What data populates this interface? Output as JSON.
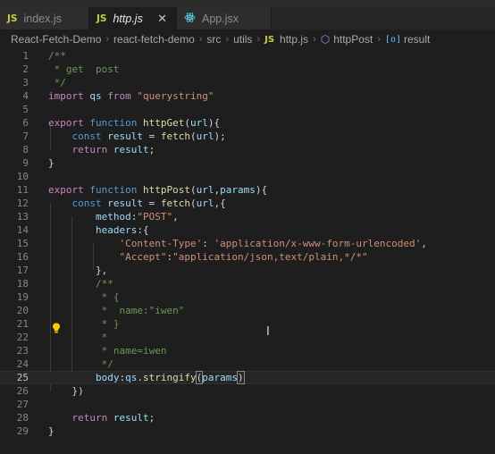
{
  "tabs": [
    {
      "icon": "JS",
      "label": "index.js"
    },
    {
      "icon": "JS",
      "label": "http.js",
      "close": "✕"
    },
    {
      "icon": "react",
      "label": "App.jsx"
    }
  ],
  "breadcrumb": [
    "React-Fetch-Demo",
    "react-fetch-demo",
    "src",
    "utils",
    "http.js",
    "httpPost",
    "result"
  ],
  "breadcrumb_icon_js": "JS",
  "line_numbers": [
    "1",
    "2",
    "3",
    "4",
    "5",
    "6",
    "7",
    "8",
    "9",
    "10",
    "11",
    "12",
    "13",
    "14",
    "15",
    "16",
    "17",
    "18",
    "19",
    "20",
    "21",
    "22",
    "23",
    "24",
    "25",
    "26",
    "27",
    "28",
    "29"
  ],
  "active_line": 25,
  "code_lines": [
    [
      [
        "cmt",
        "/**"
      ]
    ],
    [
      [
        "cmt",
        " * get  post"
      ]
    ],
    [
      [
        "cmt",
        " */"
      ]
    ],
    [
      [
        "kw",
        "import"
      ],
      [
        "pl",
        " "
      ],
      [
        "var",
        "qs"
      ],
      [
        "pl",
        " "
      ],
      [
        "kw",
        "from"
      ],
      [
        "pl",
        " "
      ],
      [
        "str",
        "\"querystring\""
      ]
    ],
    [],
    [
      [
        "kw",
        "export"
      ],
      [
        "pl",
        " "
      ],
      [
        "kb",
        "function"
      ],
      [
        "pl",
        " "
      ],
      [
        "fn",
        "httpGet"
      ],
      [
        "pl",
        "("
      ],
      [
        "var",
        "url"
      ],
      [
        "pl",
        "){"
      ]
    ],
    [
      [
        "pl",
        "    "
      ],
      [
        "kb",
        "const"
      ],
      [
        "pl",
        " "
      ],
      [
        "var",
        "result"
      ],
      [
        "pl",
        " = "
      ],
      [
        "fn",
        "fetch"
      ],
      [
        "pl",
        "("
      ],
      [
        "var",
        "url"
      ],
      [
        "pl",
        ");"
      ]
    ],
    [
      [
        "pl",
        "    "
      ],
      [
        "kw",
        "return"
      ],
      [
        "pl",
        " "
      ],
      [
        "var",
        "result"
      ],
      [
        "pl",
        ";"
      ]
    ],
    [
      [
        "pl",
        "}"
      ]
    ],
    [],
    [
      [
        "kw",
        "export"
      ],
      [
        "pl",
        " "
      ],
      [
        "kb",
        "function"
      ],
      [
        "pl",
        " "
      ],
      [
        "fn",
        "httpPost"
      ],
      [
        "pl",
        "("
      ],
      [
        "var",
        "url"
      ],
      [
        "pl",
        ","
      ],
      [
        "var",
        "params"
      ],
      [
        "pl",
        "){"
      ]
    ],
    [
      [
        "pl",
        "    "
      ],
      [
        "kb",
        "const"
      ],
      [
        "pl",
        " "
      ],
      [
        "var",
        "result"
      ],
      [
        "pl",
        " = "
      ],
      [
        "fn",
        "fetch"
      ],
      [
        "pl",
        "("
      ],
      [
        "var",
        "url"
      ],
      [
        "pl",
        ",{"
      ]
    ],
    [
      [
        "pl",
        "        "
      ],
      [
        "var",
        "method"
      ],
      [
        "pl",
        ":"
      ],
      [
        "str",
        "\"POST\""
      ],
      [
        "pl",
        ","
      ]
    ],
    [
      [
        "pl",
        "        "
      ],
      [
        "var",
        "headers"
      ],
      [
        "pl",
        ":{"
      ]
    ],
    [
      [
        "pl",
        "            "
      ],
      [
        "str",
        "'Content-Type'"
      ],
      [
        "pl",
        ": "
      ],
      [
        "str",
        "'application/x-www-form-urlencoded'"
      ],
      [
        "pl",
        ","
      ]
    ],
    [
      [
        "pl",
        "            "
      ],
      [
        "str",
        "\"Accept\""
      ],
      [
        "pl",
        ":"
      ],
      [
        "str",
        "\"application/json,text/plain,*/*\""
      ]
    ],
    [
      [
        "pl",
        "        },"
      ]
    ],
    [
      [
        "pl",
        "        "
      ],
      [
        "cmt",
        "/**"
      ]
    ],
    [
      [
        "pl",
        "         "
      ],
      [
        "cmt",
        "* {"
      ]
    ],
    [
      [
        "pl",
        "         "
      ],
      [
        "cmt",
        "*  name:\"iwen\""
      ]
    ],
    [
      [
        "pl",
        "         "
      ],
      [
        "cmt",
        "* }"
      ]
    ],
    [
      [
        "pl",
        "         "
      ],
      [
        "cmt",
        "*"
      ]
    ],
    [
      [
        "pl",
        "         "
      ],
      [
        "cmt",
        "* name=iwen"
      ]
    ],
    [
      [
        "pl",
        "         "
      ],
      [
        "cmt",
        "*/"
      ]
    ],
    [
      [
        "pl",
        "        "
      ],
      [
        "var",
        "body"
      ],
      [
        "pl",
        ":"
      ],
      [
        "var",
        "qs"
      ],
      [
        "pl",
        "."
      ],
      [
        "fn",
        "stringify"
      ],
      [
        "br",
        "("
      ],
      [
        "var",
        "params"
      ],
      [
        "br",
        ")"
      ]
    ],
    [
      [
        "pl",
        "    })"
      ]
    ],
    [],
    [
      [
        "pl",
        "    "
      ],
      [
        "kw",
        "return"
      ],
      [
        "pl",
        " "
      ],
      [
        "var",
        "result"
      ],
      [
        "pl",
        ";"
      ]
    ],
    [
      [
        "pl",
        "}"
      ]
    ]
  ],
  "colors": {
    "background": "#1e1e1e",
    "comment": "#6a9955",
    "keyword_control": "#c586c0",
    "keyword_storage": "#569cd6",
    "function": "#dcdcaa",
    "variable": "#9cdcfe",
    "string": "#ce9178",
    "js_icon": "#cbcb41",
    "react_icon": "#61dafb"
  },
  "icons": [
    "js-file-icon",
    "react-file-icon",
    "close-icon",
    "symbol-method-icon",
    "symbol-property-icon",
    "lightbulb-icon",
    "text-cursor-icon"
  ]
}
